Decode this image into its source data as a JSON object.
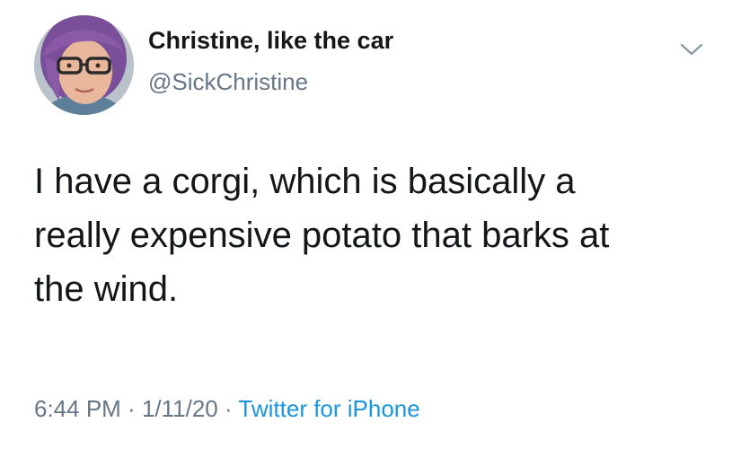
{
  "user": {
    "display_name": "Christine, like the car",
    "handle": "@SickChristine"
  },
  "tweet": {
    "lines": [
      "I have a corgi, which is basically a",
      "really expensive potato that barks at",
      "the wind."
    ]
  },
  "meta": {
    "time": "6:44 PM",
    "sep1": " · ",
    "date": "1/11/20",
    "sep2": " · ",
    "source": "Twitter for iPhone"
  },
  "icons": {
    "menu": "chevron-down-icon",
    "avatar": "avatar"
  },
  "colors": {
    "text": "#14171a",
    "secondary": "#657786",
    "link": "#1b95e0",
    "hair": "#8a5aa8"
  }
}
